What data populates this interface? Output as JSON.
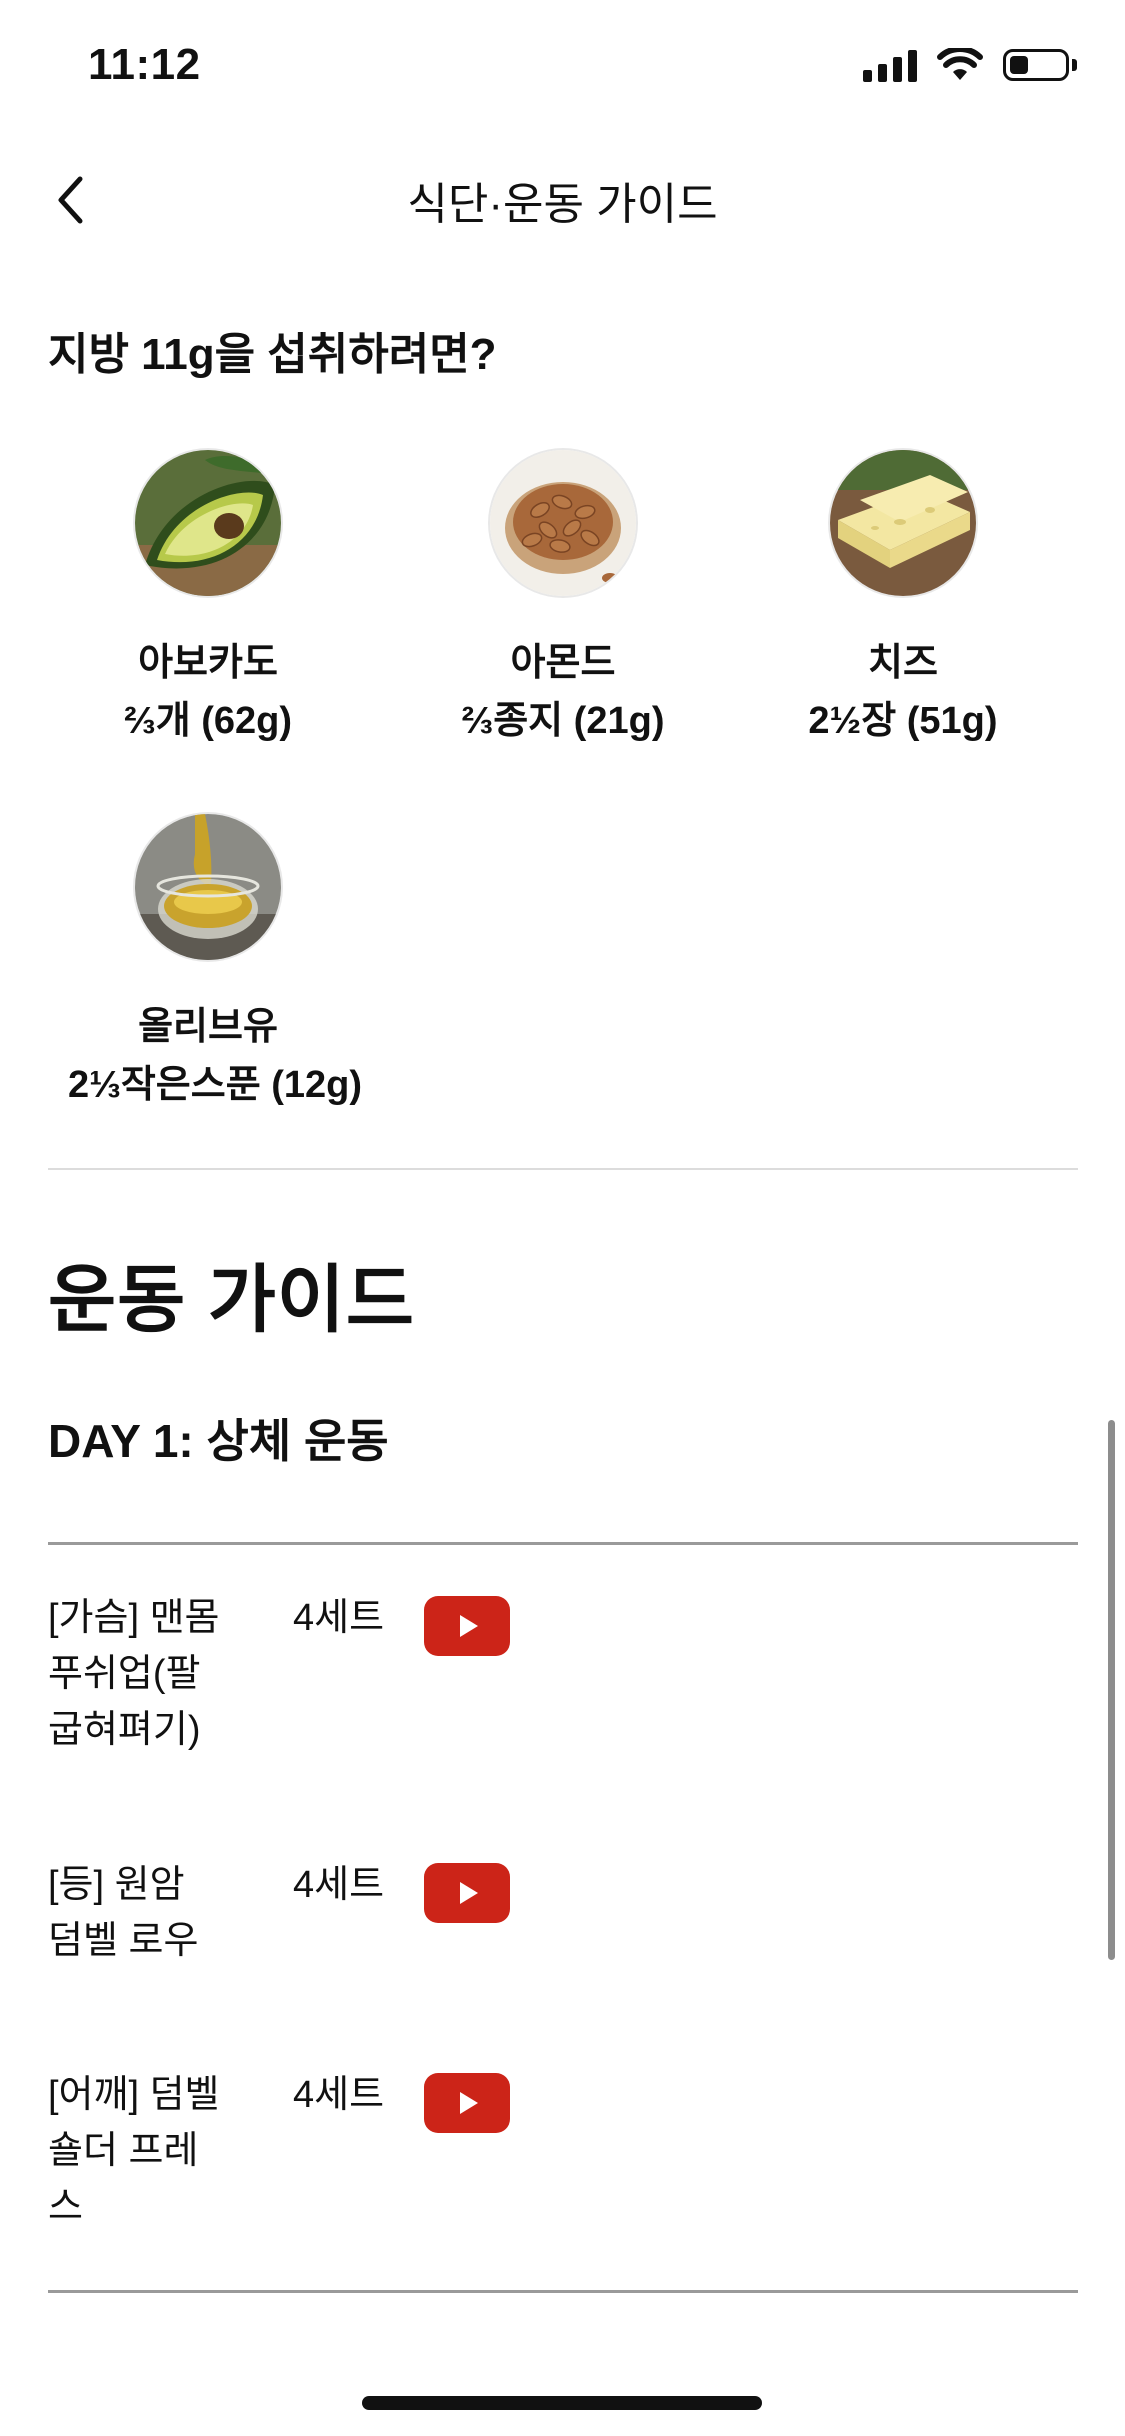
{
  "status_bar": {
    "time": "11:12",
    "battery_level": 0.35
  },
  "nav": {
    "title": "식단·운동 가이드"
  },
  "fat_section": {
    "title": "지방 11g을 섭취하려면?",
    "foods": [
      {
        "name": "아보카도",
        "amount": "⅔개 (62g)",
        "image": "avocado-image"
      },
      {
        "name": "아몬드",
        "amount": "⅔종지 (21g)",
        "image": "almond-image"
      },
      {
        "name": "치즈",
        "amount": "2½장 (51g)",
        "image": "cheese-image"
      },
      {
        "name": "올리브유",
        "amount": "2⅓작은스푼 (12g)",
        "image": "olive-oil-image"
      }
    ]
  },
  "exercise_section": {
    "title": "운동 가이드",
    "day_title": "DAY 1: 상체 운동",
    "exercises": [
      {
        "name_lines": [
          "[가슴] 맨몸",
          "푸쉬업(팔",
          "굽혀펴기)"
        ],
        "sets": "4세트"
      },
      {
        "name_lines": [
          "[등] 원암",
          "덤벨 로우"
        ],
        "sets": "4세트"
      },
      {
        "name_lines": [
          "[어깨] 덤벨",
          "숄더 프레",
          "스"
        ],
        "sets": "4세트"
      }
    ]
  },
  "colors": {
    "youtube_red": "#cc2418",
    "divider": "#dcdcdc"
  },
  "icons": {
    "back": "chevron-left-icon",
    "play": "youtube-play-icon",
    "signal": "cellular-signal-icon",
    "wifi": "wifi-icon",
    "battery": "battery-icon"
  }
}
